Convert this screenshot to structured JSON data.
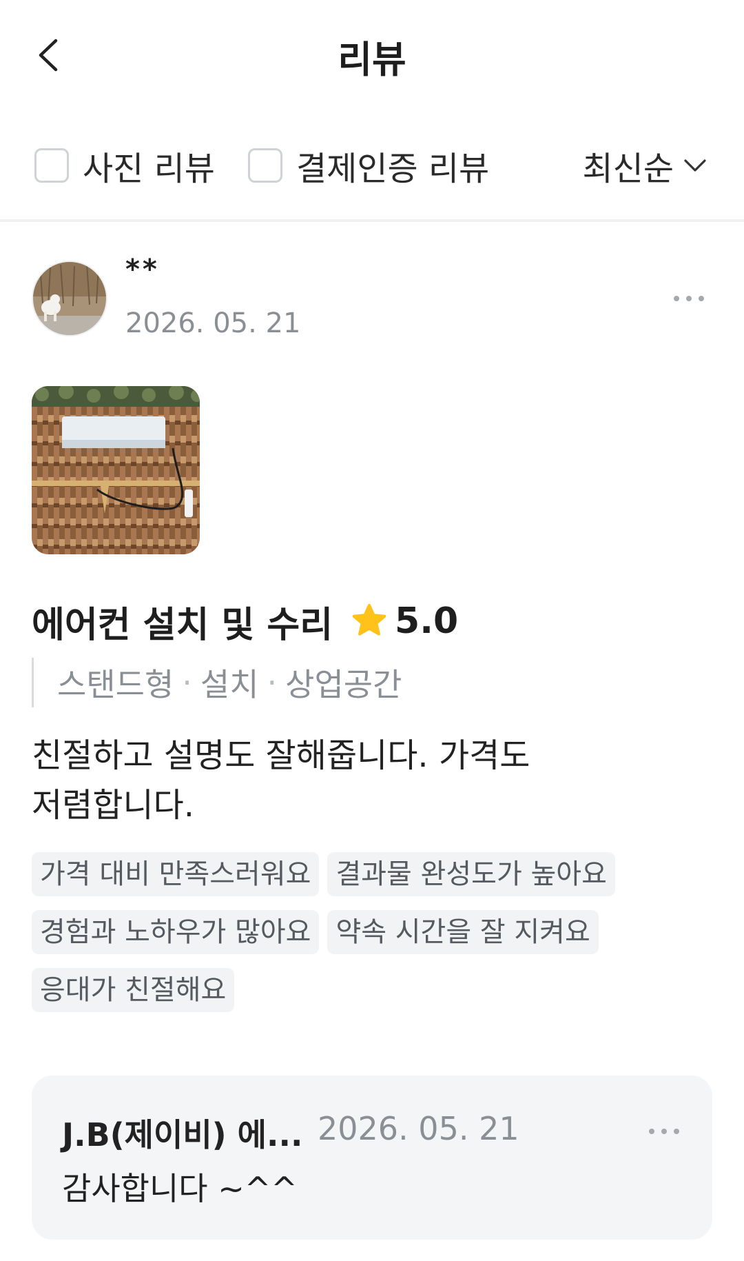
{
  "header": {
    "title": "리뷰",
    "back_icon": "chevron-left-icon"
  },
  "filters": {
    "photo_review_label": "사진 리뷰",
    "photo_review_checked": false,
    "payment_review_label": "결제인증 리뷰",
    "payment_review_checked": false,
    "sort_label": "최신순",
    "sort_icon": "chevron-down-icon"
  },
  "review": {
    "user_name": "**",
    "date": "2026. 05. 21",
    "service_title": "에어컨 설치 및 수리",
    "rating": "5.0",
    "rating_color": "#FFC21A",
    "options": [
      "스탠드형",
      "설치",
      "상업공간"
    ],
    "option_separator": "·",
    "text_line1": "친절하고 설명도 잘해줍니다. 가격도",
    "text_line2": "저렴합니다.",
    "tags": [
      "가격 대비 만족스러워요",
      "결과물 완성도가 높아요",
      "경험과 노하우가 많아요",
      "약속 시간을 잘 지켜요",
      "응대가 친절해요"
    ]
  },
  "reply": {
    "author": "J.B(제이비) 에...",
    "date": "2026. 05. 21",
    "text": "감사합니다 ~^^"
  }
}
